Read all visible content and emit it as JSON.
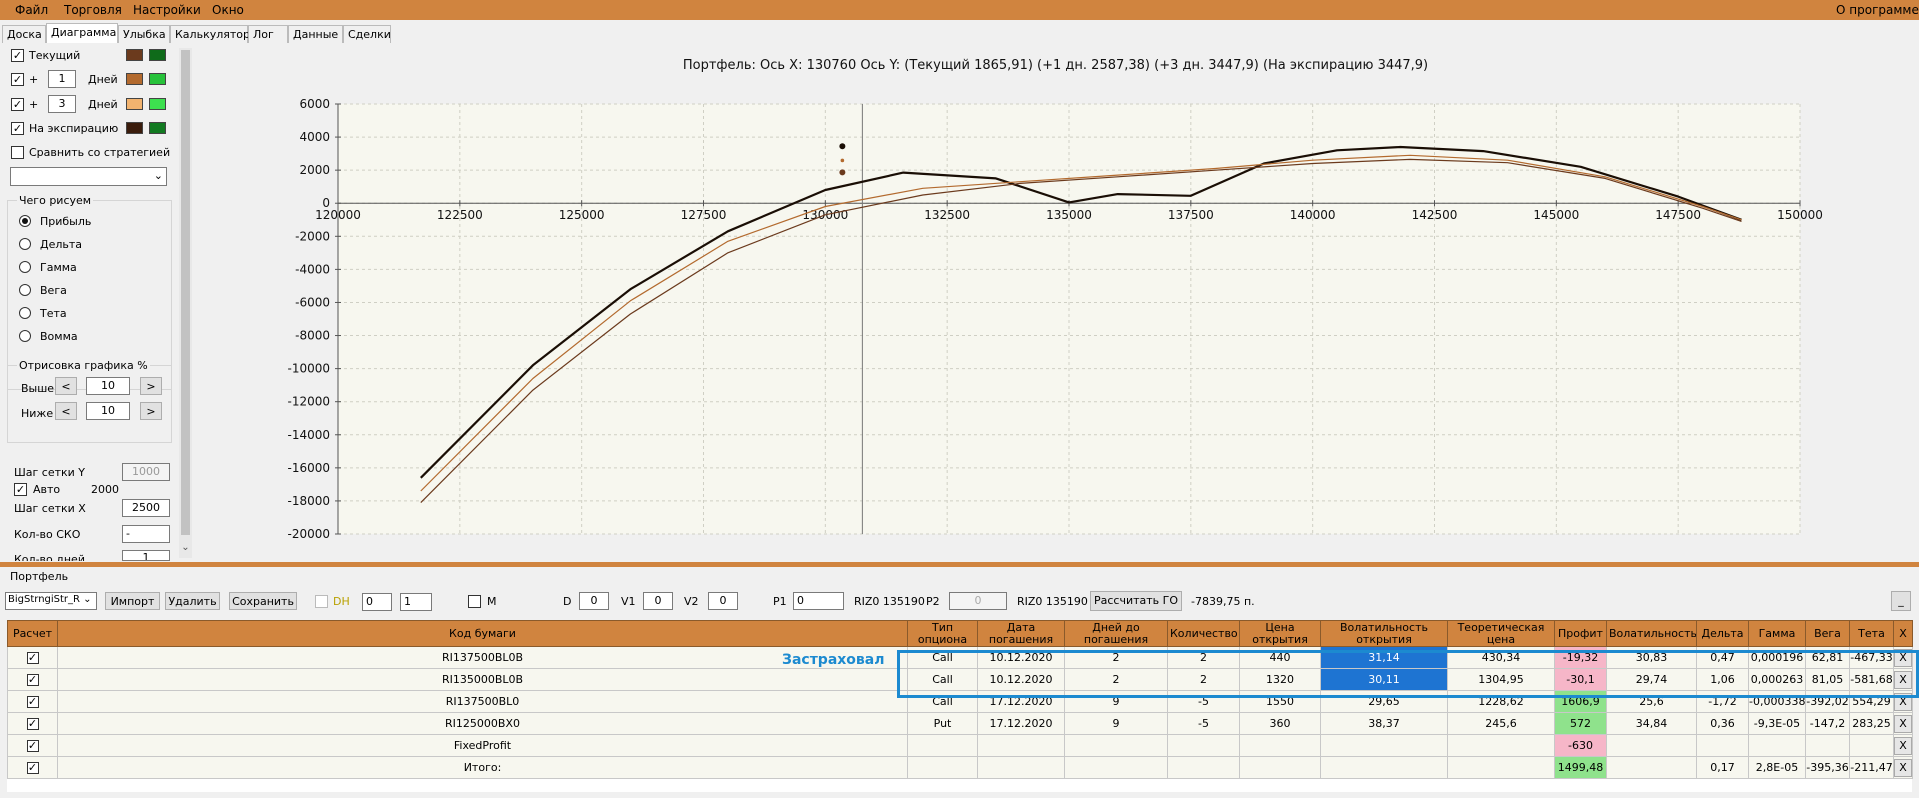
{
  "menu": {
    "items": [
      "Файл",
      "Торговля",
      "Настройки",
      "Окно"
    ],
    "about": "О программе"
  },
  "tabs": [
    "Доска",
    "Диаграмма",
    "Улыбка",
    "Калькулятор",
    "Лог",
    "Данные",
    "Сделки"
  ],
  "left": {
    "current_label": "Текущий",
    "plus_label": "+",
    "days_label": "Дней",
    "days1": "1",
    "days2": "3",
    "expiry_label": "На экспирацию",
    "compare_label": "Сравнить со стратегией",
    "draw_group": "Чего рисуем",
    "radios": [
      "Прибыль",
      "Дельта",
      "Гамма",
      "Вега",
      "Тета",
      "Вомма"
    ],
    "render_group": "Отрисовка графика %",
    "above_label": "Выше",
    "below_label": "Ниже",
    "above_val": "10",
    "below_val": "10",
    "dec": "<",
    "inc": ">",
    "grid_y_label": "Шаг сетки Y",
    "grid_y_val": "1000",
    "auto_label": "Авто",
    "auto_val": "2000",
    "grid_x_label": "Шаг сетки X",
    "grid_x_val": "2500",
    "sko_label": "Кол-во СКО",
    "sko_val": "-",
    "days_count_label": "Кол-во дней",
    "days_count_val": "1",
    "colors": {
      "current_a": "#6b3a1d",
      "current_b": "#0f6b1a",
      "d1_a": "#b36a2e",
      "d1_b": "#27c23a",
      "d3_a": "#f2b36f",
      "d3_b": "#3de04f",
      "exp_a": "#3a1c0c",
      "exp_b": "#127a21"
    }
  },
  "chart": {
    "title": "Портфель: Ось X:  130760  Ось Y:  (Текущий 1865,91)  (+1 дн. 2587,38)  (+3 дн. 3447,9)  (На экспирацию 3447,9)"
  },
  "chart_data": {
    "type": "line",
    "title": "Портфель: Ось X:  130760  Ось Y:  (Текущий 1865,91)  (+1 дн. 2587,38)  (+3 дн. 3447,9)  (На экспирацию 3447,9)",
    "xlim": [
      120000,
      150000
    ],
    "ylim": [
      -20000,
      6000
    ],
    "x_ticks": [
      "120000",
      "122500",
      "125000",
      "127500",
      "130000",
      "132500",
      "135000",
      "137500",
      "140000",
      "142500",
      "145000",
      "147500",
      "150000"
    ],
    "y_ticks": [
      "6000",
      "4000",
      "2000",
      "0",
      "-2000",
      "-4000",
      "-6000",
      "-8000",
      "-10000",
      "-12000",
      "-14000",
      "-16000",
      "-18000",
      "-20000"
    ],
    "cursor_x": 130760,
    "series": [
      {
        "color": "#1a0e05",
        "width": 2.2,
        "x": [
          121700,
          124000,
          126000,
          128000,
          130000,
          131600,
          133500,
          135000,
          136000,
          137500,
          139000,
          140500,
          141800,
          143500,
          145500,
          147500,
          148800
        ],
        "y": [
          -16600,
          -9800,
          -5200,
          -1700,
          800,
          1850,
          1500,
          50,
          550,
          450,
          2400,
          3200,
          3400,
          3150,
          2200,
          400,
          -1000
        ]
      },
      {
        "color": "#b36a2e",
        "width": 1.2,
        "x": [
          121700,
          124000,
          126000,
          128000,
          130000,
          132000,
          134000,
          136000,
          138000,
          140000,
          142000,
          144000,
          146000,
          148000,
          148800
        ],
        "y": [
          -17400,
          -10600,
          -5900,
          -2300,
          -200,
          900,
          1300,
          1700,
          2100,
          2600,
          2900,
          2600,
          1600,
          -200,
          -1000
        ]
      },
      {
        "color": "#6b3a1d",
        "width": 1.2,
        "x": [
          121700,
          124000,
          126000,
          128000,
          130000,
          132000,
          134000,
          136000,
          138000,
          140000,
          142000,
          144000,
          146000,
          148000,
          148800
        ],
        "y": [
          -18100,
          -11300,
          -6700,
          -3000,
          -700,
          500,
          1200,
          1600,
          2000,
          2400,
          2650,
          2450,
          1500,
          -300,
          -1100
        ]
      }
    ],
    "markers": [
      {
        "x": 130760,
        "y": 3447.9,
        "color": "#1a0e05"
      },
      {
        "x": 130760,
        "y": 2587.38,
        "color": "#b36a2e"
      },
      {
        "x": 130760,
        "y": 1865.91,
        "color": "#6b3a1d"
      }
    ]
  },
  "portfolio": {
    "label": "Портфель",
    "strategy": "BigStrngiStr_R",
    "import": "Импорт",
    "delete": "Удалить",
    "save": "Сохранить",
    "dh": "DH",
    "dh_v1": "0",
    "dh_v2": "1",
    "m": "M",
    "d_label": "D",
    "d_val": "0",
    "v1_label": "V1",
    "v1_val": "0",
    "v2_label": "V2",
    "v2_val": "0",
    "p1_label": "P1",
    "p1_val": "0",
    "riz1": "RIZ0 135190",
    "p2_label": "P2",
    "p2_val": "0",
    "riz2": "RIZ0 135190",
    "calc_go": "Рассчитать ГО",
    "go_val": "-7839,75 п.",
    "minimize": "_"
  },
  "table": {
    "headers": [
      "Расчет",
      "Код бумаги",
      "Тип опциона",
      "Дата погашения",
      "Дней до погашения",
      "Количество",
      "Цена открытия",
      "Волатильность открытия",
      "Теоретическая цена",
      "Профит",
      "Волатильность",
      "Дельта",
      "Гамма",
      "Вега",
      "Тета",
      "X"
    ],
    "rows": [
      [
        "RI137500BL0B",
        "Call",
        "10.12.2020",
        "2",
        "2",
        "440",
        "31,14",
        "430,34",
        "-19,32",
        "30,83",
        "0,47",
        "0,000196",
        "62,81",
        "-467,33"
      ],
      [
        "RI135000BL0B",
        "Call",
        "10.12.2020",
        "2",
        "2",
        "1320",
        "30,11",
        "1304,95",
        "-30,1",
        "29,74",
        "1,06",
        "0,000263",
        "81,05",
        "-581,68"
      ],
      [
        "RI137500BL0",
        "Call",
        "17.12.2020",
        "9",
        "-5",
        "1550",
        "29,65",
        "1228,62",
        "1606,9",
        "25,6",
        "-1,72",
        "-0,000338",
        "-392,02",
        "554,29"
      ],
      [
        "RI125000BX0",
        "Put",
        "17.12.2020",
        "9",
        "-5",
        "360",
        "38,37",
        "245,6",
        "572",
        "34,84",
        "0,36",
        "-9,3E-05",
        "-147,2",
        "283,25"
      ],
      [
        "FixedProfit",
        "",
        "",
        "",
        "",
        "",
        "",
        "",
        "-630",
        "",
        "",
        "",
        "",
        ""
      ],
      [
        "Итого:",
        "",
        "",
        "",
        "",
        "",
        "",
        "",
        "1499,48",
        "",
        "0,17",
        "2,8E-05",
        "-395,36",
        "-211,47"
      ]
    ],
    "x_label": "X"
  },
  "annotation": {
    "label": "Застраховал"
  }
}
